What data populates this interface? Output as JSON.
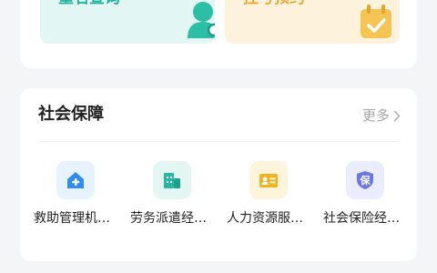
{
  "top_tiles": [
    {
      "label": "重名查询",
      "icon": "person-search-icon",
      "color": "#22b39b",
      "bg": "#e2f6f3"
    },
    {
      "label": "挂号预约",
      "icon": "calendar-check-icon",
      "color": "#eba62c",
      "bg": "#fdf3dd"
    }
  ],
  "social_security": {
    "title": "社会保障",
    "more_label": "更多",
    "items": [
      {
        "label": "救助管理机…",
        "icon": "home-plus-icon",
        "color": "#2f8df0",
        "bg": "#e6f3fd"
      },
      {
        "label": "劳务派遣经…",
        "icon": "building-icon",
        "color": "#26b8a0",
        "bg": "#e3f6f2"
      },
      {
        "label": "人力资源服…",
        "icon": "id-card-icon",
        "color": "#f0b420",
        "bg": "#fdf4dc"
      },
      {
        "label": "社会保险经…",
        "icon": "shield-bao-icon",
        "color": "#6a77e8",
        "bg": "#ecedfc",
        "glyph": "保"
      }
    ]
  }
}
